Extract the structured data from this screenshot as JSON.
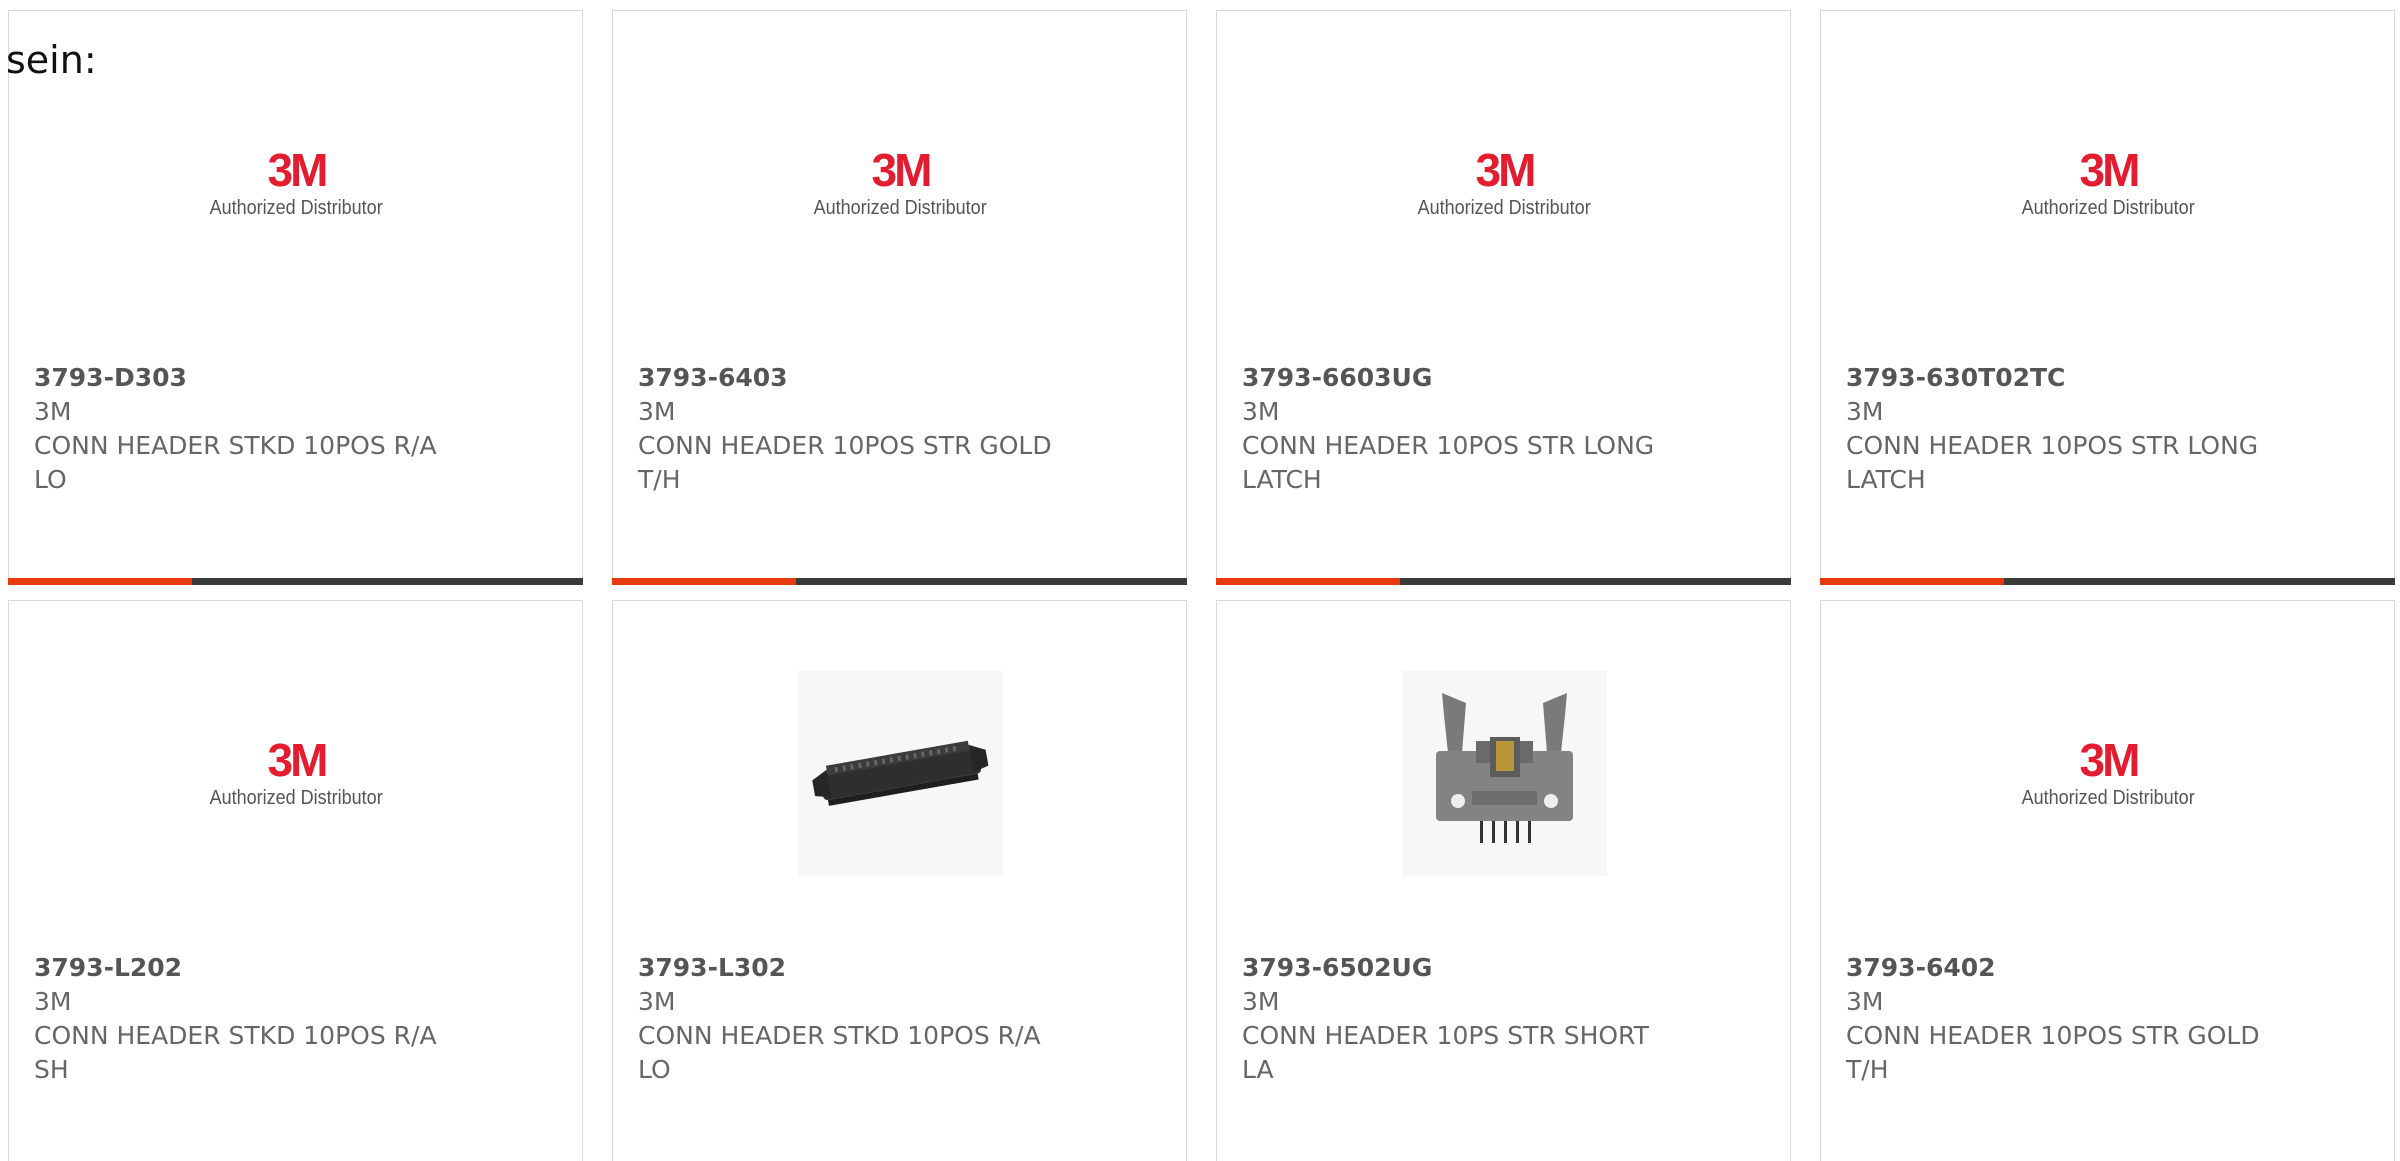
{
  "intro_text": "sein:",
  "brand_logo": {
    "mark": "3M",
    "subtitle": "Authorized Distributor"
  },
  "colors": {
    "accent": "#e8380d",
    "bar": "#3a3a3a",
    "text": "#666666",
    "border": "#d9d9d9",
    "logo_red": "#e31d2f"
  },
  "products": [
    {
      "part_number": "3793-D303",
      "manufacturer": "3M",
      "description_line1": "CONN HEADER STKD 10POS R/A",
      "description_line2": "LO",
      "image": "3m-logo"
    },
    {
      "part_number": "3793-6403",
      "manufacturer": "3M",
      "description_line1": "CONN HEADER 10POS STR GOLD",
      "description_line2": "T/H",
      "image": "3m-logo"
    },
    {
      "part_number": "3793-6603UG",
      "manufacturer": "3M",
      "description_line1": "CONN HEADER 10POS STR LONG",
      "description_line2": "LATCH",
      "image": "3m-logo"
    },
    {
      "part_number": "3793-630T02TC",
      "manufacturer": "3M",
      "description_line1": "CONN HEADER 10POS STR LONG",
      "description_line2": "LATCH",
      "image": "3m-logo"
    },
    {
      "part_number": "3793-L202",
      "manufacturer": "3M",
      "description_line1": "CONN HEADER STKD 10POS R/A",
      "description_line2": "SH",
      "image": "3m-logo"
    },
    {
      "part_number": "3793-L302",
      "manufacturer": "3M",
      "description_line1": "CONN HEADER STKD 10POS R/A",
      "description_line2": "LO",
      "image": "connector-angled-photo"
    },
    {
      "part_number": "3793-6502UG",
      "manufacturer": "3M",
      "description_line1": "CONN HEADER 10PS STR SHORT",
      "description_line2": "LA",
      "image": "connector-latch-photo"
    },
    {
      "part_number": "3793-6402",
      "manufacturer": "3M",
      "description_line1": "CONN HEADER 10POS STR GOLD",
      "description_line2": "T/H",
      "image": "3m-logo"
    }
  ]
}
